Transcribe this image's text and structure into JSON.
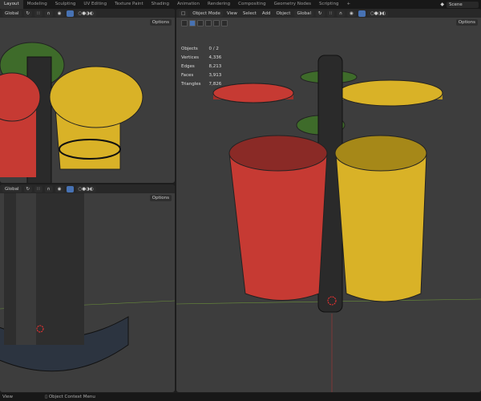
{
  "topbar": {
    "tabs": [
      "Layout",
      "Modeling",
      "Sculpting",
      "UV Editing",
      "Texture Paint",
      "Shading",
      "Animation",
      "Rendering",
      "Compositing",
      "Geometry Nodes",
      "Scripting"
    ],
    "add_tab": "+",
    "scene": "Scene"
  },
  "viewport_header": {
    "orientation": "Global",
    "options": "Options"
  },
  "main_header": {
    "mode": "Object Mode",
    "menus": [
      "View",
      "Select",
      "Add",
      "Object"
    ],
    "orientation": "Global",
    "options": "Options"
  },
  "stats": [
    {
      "label": "Objects",
      "value": "0 / 2"
    },
    {
      "label": "Vertices",
      "value": "4,336"
    },
    {
      "label": "Edges",
      "value": "8,213"
    },
    {
      "label": "Faces",
      "value": "3,913"
    },
    {
      "label": "Triangles",
      "value": "7,826"
    }
  ],
  "status": {
    "left": "View",
    "middle": "Object Context Menu"
  },
  "colors": {
    "red": "#c63a33",
    "yellow": "#d9b227",
    "green": "#3e6b2a",
    "pole": "#2a2a2a",
    "accent": "#4772b3"
  }
}
